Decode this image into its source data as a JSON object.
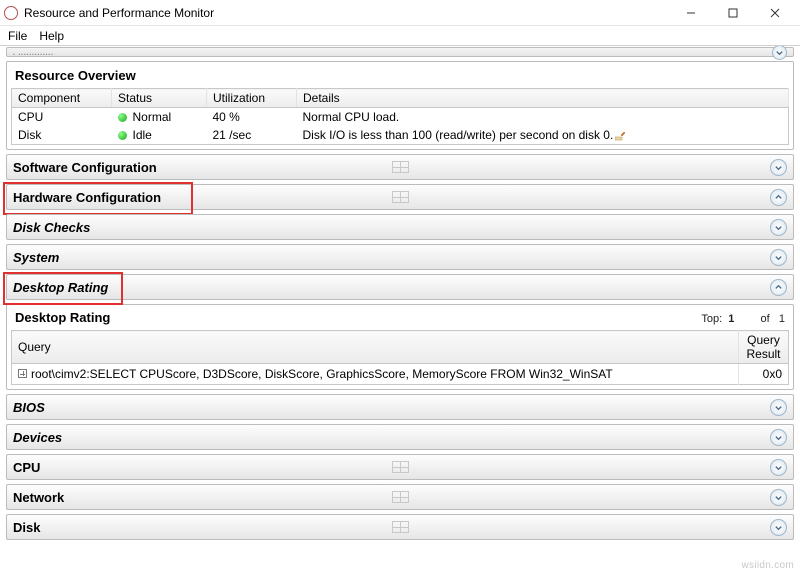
{
  "window": {
    "title": "Resource and Performance Monitor"
  },
  "menu": {
    "file": "File",
    "help": "Help"
  },
  "cutoff_label": "Performance",
  "overview": {
    "title": "Resource Overview",
    "headers": {
      "component": "Component",
      "status": "Status",
      "utilization": "Utilization",
      "details": "Details"
    },
    "rows": [
      {
        "component": "CPU",
        "status": "Normal",
        "utilization": "40 %",
        "details": "Normal CPU load."
      },
      {
        "component": "Disk",
        "status": "Idle",
        "utilization": "21 /sec",
        "details": "Disk I/O is less than 100 (read/write) per second on disk 0."
      }
    ]
  },
  "sections": {
    "software": {
      "label": "Software Configuration",
      "italic": false,
      "center_icon": true,
      "expanded": false,
      "highlight": false
    },
    "hardware": {
      "label": "Hardware Configuration",
      "italic": false,
      "center_icon": true,
      "expanded": true,
      "highlight": true
    },
    "diskchk": {
      "label": "Disk Checks",
      "italic": true,
      "center_icon": false,
      "expanded": false,
      "highlight": false
    },
    "system": {
      "label": "System",
      "italic": true,
      "center_icon": false,
      "expanded": false,
      "highlight": false
    },
    "drating": {
      "label": "Desktop Rating",
      "italic": true,
      "center_icon": false,
      "expanded": true,
      "highlight": true
    },
    "bios": {
      "label": "BIOS",
      "italic": true,
      "center_icon": false,
      "expanded": false,
      "highlight": false
    },
    "devices": {
      "label": "Devices",
      "italic": true,
      "center_icon": false,
      "expanded": false,
      "highlight": false
    },
    "cpu": {
      "label": "CPU",
      "italic": false,
      "center_icon": true,
      "expanded": false,
      "highlight": false
    },
    "network": {
      "label": "Network",
      "italic": false,
      "center_icon": true,
      "expanded": false,
      "highlight": false
    },
    "disk": {
      "label": "Disk",
      "italic": false,
      "center_icon": true,
      "expanded": false,
      "highlight": false
    }
  },
  "desktop_rating": {
    "title": "Desktop Rating",
    "top_label": "Top:",
    "top_value": "1",
    "of_label": "of",
    "of_value": "1",
    "query_header": "Query",
    "result_header": "Query Result",
    "query_text": "root\\cimv2:SELECT CPUScore, D3DScore, DiskScore, GraphicsScore, MemoryScore FROM Win32_WinSAT",
    "result_value": "0x0"
  },
  "watermark": "wsiidn.com"
}
